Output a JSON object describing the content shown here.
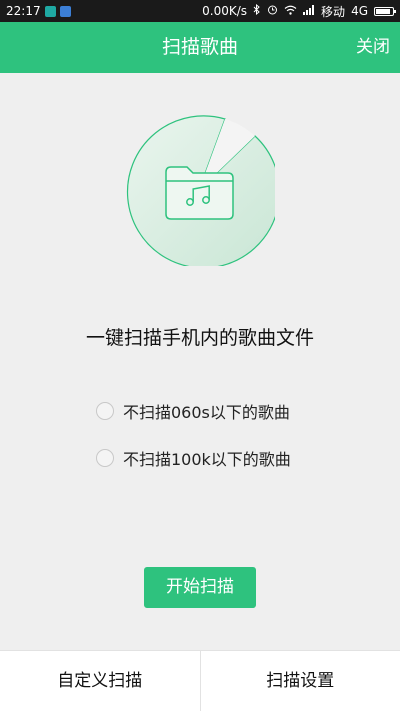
{
  "status_bar": {
    "time": "22:17",
    "speed": "0.00K/s",
    "carrier": "移动",
    "network": "4G",
    "battery_level": 0.85
  },
  "header": {
    "title": "扫描歌曲",
    "close_label": "关闭"
  },
  "illustration": {
    "icon": "music-folder-icon",
    "accent_color": "#2ec27e"
  },
  "main": {
    "headline": "一键扫描手机内的歌曲文件",
    "options": [
      {
        "label": "不扫描060s以下的歌曲",
        "checked": false
      },
      {
        "label": "不扫描100k以下的歌曲",
        "checked": false
      }
    ],
    "start_label": "开始扫描"
  },
  "bottom": {
    "custom_scan_label": "自定义扫描",
    "settings_label": "扫描设置"
  },
  "colors": {
    "accent": "#2ec27e",
    "background": "#efefef"
  }
}
